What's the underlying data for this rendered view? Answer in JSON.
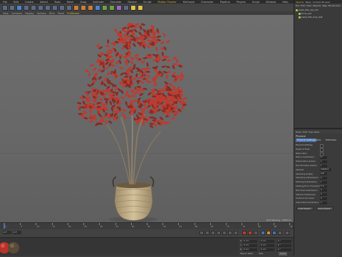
{
  "menubar": {
    "items": [
      "File",
      "Edit",
      "Create",
      "Select",
      "Tools",
      "Mesh",
      "Snap",
      "Animate",
      "Simulate",
      "Render",
      "Sculpt",
      "Motion Tracker",
      "MoGraph",
      "Character",
      "Pipeline",
      "Plugins",
      "Script",
      "Window",
      "Help"
    ],
    "highlight": "Motion Tracker"
  },
  "viewport": {
    "menu": [
      "View",
      "Cameras",
      "Display",
      "Options",
      "Filter",
      "Panel",
      "ProRender"
    ],
    "info": "Grid Spacing : 1000 cm"
  },
  "timeline": {
    "ticks": [
      "0",
      "5",
      "10",
      "15",
      "20",
      "25",
      "30",
      "35",
      "40",
      "45",
      "50",
      "55",
      "60",
      "65",
      "70",
      "75",
      "80",
      "85",
      "90"
    ],
    "end_frame": "90 F"
  },
  "transport": {
    "start_field": "0 F",
    "current_field": "0 F",
    "end_field": "90 F",
    "max_field": "90 F"
  },
  "coordinates": {
    "rows": [
      {
        "axis": "X",
        "pos": "0 cm",
        "size": "0 cm",
        "rot": "0 °"
      },
      {
        "axis": "Y",
        "pos": "0 cm",
        "size": "0 cm",
        "rot": "0 °"
      },
      {
        "axis": "Z",
        "pos": "0 cm",
        "size": "0 cm",
        "rot": "0 °"
      }
    ],
    "mode": "Object (Rel)",
    "size_mode": "Size",
    "apply": "Apply"
  },
  "object_manager": {
    "tabs": [
      "Objects",
      "Takes",
      "Content Browser"
    ],
    "menu": [
      "File",
      "Edit",
      "View",
      "Objects",
      "Tags",
      "Bookmarks"
    ],
    "objects": [
      {
        "name": "plant_001_obj_r20",
        "color": "#9ad04a"
      },
      {
        "name": "Ficus_pot",
        "color": "#9ad04a"
      },
      {
        "name": "plant_001_tree_leaf",
        "color": "#9ad04a"
      }
    ]
  },
  "attributes": {
    "menu": [
      "Mode",
      "Edit",
      "User Data"
    ],
    "title": "Physical",
    "tabs": [
      "Physical Settings",
      "Save",
      "Multi-Pass"
    ],
    "rows": [
      {
        "label": "Physical Settings",
        "value": ""
      },
      {
        "label": "Depth of Field",
        "value": ""
      },
      {
        "label": "Motion Blur",
        "value": ""
      },
      {
        "label": "Motion Subdivision",
        "value": "2"
      },
      {
        "label": "Deformation Subdiv.",
        "value": "2"
      },
      {
        "label": "Hair Primitive Subdiv.",
        "value": "1"
      },
      {
        "label": "Sampler",
        "value": "Adaptive"
      },
      {
        "label": "Sampling Quality",
        "value": "Low"
      },
      {
        "label": "Sampling Subdivisions",
        "value": "2"
      },
      {
        "label": "Shading Subdivisions",
        "value": "1"
      },
      {
        "label": "Shading Error Threshold",
        "value": "5 %"
      },
      {
        "label": "Blurriness Subdivision",
        "value": "3"
      },
      {
        "label": "Shadow Subdivision",
        "value": "3"
      },
      {
        "label": "Ambient Occlusion",
        "value": "3"
      },
      {
        "label": "Subsurface Subdivision",
        "value": "3"
      }
    ],
    "buttons": [
      "Load Preset...",
      "Save Preset..."
    ]
  },
  "colors": {
    "leaf_red": "#c3382c",
    "leaf_dark": "#8a2a22",
    "trunk": "#8a7a62",
    "basket": "#c8b48d",
    "accent_blue": "#4e73b0"
  }
}
